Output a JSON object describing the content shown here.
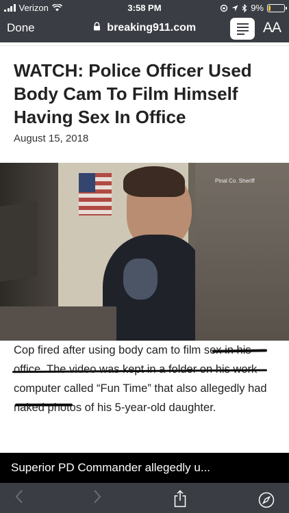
{
  "status_bar": {
    "carrier": "Verizon",
    "time": "3:58 PM",
    "battery": "9%",
    "battery_level": 0.09,
    "battery_color": "#e8c23a"
  },
  "browser": {
    "done_label": "Done",
    "url": "breaking911.com",
    "text_size_label": "AA"
  },
  "article": {
    "headline": "WATCH: Police Officer Used Body Cam To Film Himself Having Sex In Office",
    "date": "August 15, 2018",
    "image_caption": "Pinal Co. Sheriff",
    "body": "Cop fired after using body cam to film sex in his office. The video was kept in a folder on his work computer called “Fun Time” that also allegedly had naked photos of his 5-year-old daughter."
  },
  "banner": {
    "text": "Superior PD Commander allegedly u..."
  },
  "bottom_bar": {
    "back_icon": "chevron-left-icon",
    "forward_icon": "chevron-right-icon",
    "share_icon": "share-icon",
    "safari_icon": "compass-icon"
  }
}
